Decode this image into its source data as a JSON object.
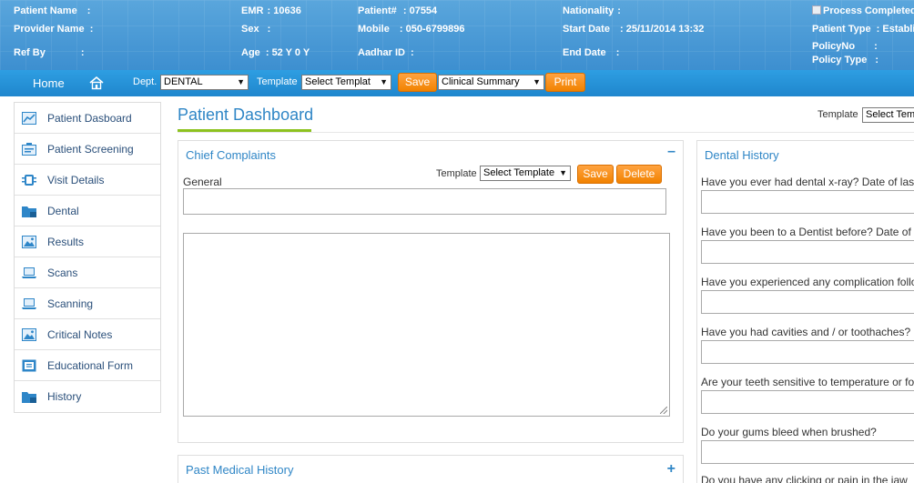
{
  "banner": {
    "patient_name_label": "Patient Name",
    "patient_name_value": ":",
    "provider_name_label": "Provider Name",
    "provider_name_value": ":",
    "ref_by_label": "Ref By",
    "ref_by_value": ":",
    "emr_label": "EMR",
    "emr_value": ": 10636",
    "sex_label": "Sex",
    "sex_value": ":",
    "age_label": "Age",
    "age_value": ": 52 Y 0 Y",
    "patient_no_label": "Patient#",
    "patient_no_value": ": 07554",
    "mobile_label": "Mobile",
    "mobile_value": ": 050-6799896",
    "aadhar_label": "Aadhar ID",
    "aadhar_value": ":",
    "nationality_label": "Nationality",
    "nationality_value": ":",
    "start_date_label": "Start Date",
    "start_date_value": ": 25/11/2014 13:32",
    "end_date_label": "End Date",
    "end_date_value": ":",
    "process_completed_label": "Process Completed",
    "patient_type_label": "Patient Type",
    "patient_type_value": ": Establis",
    "policy_no_label": "PolicyNo",
    "policy_no_value": ":",
    "policy_type_label": "Policy Type",
    "policy_type_value": ":"
  },
  "toolbar": {
    "home_label": "Home",
    "dept_label": "Dept.",
    "dept_value": "DENTAL",
    "template_label": "Template",
    "template_value": "Select Templat",
    "save_label": "Save",
    "summary_value": "Clinical Summary",
    "print_label": "Print"
  },
  "sidebar": {
    "items": [
      {
        "label": "Patient Dasboard",
        "icon": "chart-icon"
      },
      {
        "label": "Patient Screening",
        "icon": "screening-icon"
      },
      {
        "label": "Visit Details",
        "icon": "visit-icon"
      },
      {
        "label": "Dental",
        "icon": "folder-icon"
      },
      {
        "label": "Results",
        "icon": "image-icon"
      },
      {
        "label": "Scans",
        "icon": "laptop-icon"
      },
      {
        "label": "Scanning",
        "icon": "laptop-icon"
      },
      {
        "label": "Critical Notes",
        "icon": "image-icon"
      },
      {
        "label": "Educational Form",
        "icon": "form-icon"
      },
      {
        "label": "History",
        "icon": "folder-icon"
      }
    ]
  },
  "main": {
    "title": "Patient Dashboard",
    "template_label": "Template",
    "template_value": "Select Tem",
    "chief_complaints": {
      "title": "Chief Complaints",
      "toggle": "–",
      "general_label": "General",
      "template_label": "Template",
      "template_value": "Select Template",
      "save_label": "Save",
      "delete_label": "Delete"
    },
    "past_medical_history": {
      "title": "Past Medical History",
      "toggle": "+"
    },
    "dental_history": {
      "title": "Dental History",
      "questions": [
        "Have you ever had dental x-ray? Date of last",
        "Have you been to a Dentist before? Date of",
        "Have you experienced any complication follo",
        "Have you had cavities and / or toothaches?",
        "Are your teeth sensitive to temperature or fo",
        "Do your gums bleed when brushed?",
        "Do you have any clicking or pain in the jaw"
      ]
    }
  },
  "colors": {
    "banner": "#3d8fd0",
    "toolbar": "#1f86cd",
    "accent": "#2f86c6",
    "orange_button": "#f18200",
    "title_underline": "#8dc21f"
  }
}
